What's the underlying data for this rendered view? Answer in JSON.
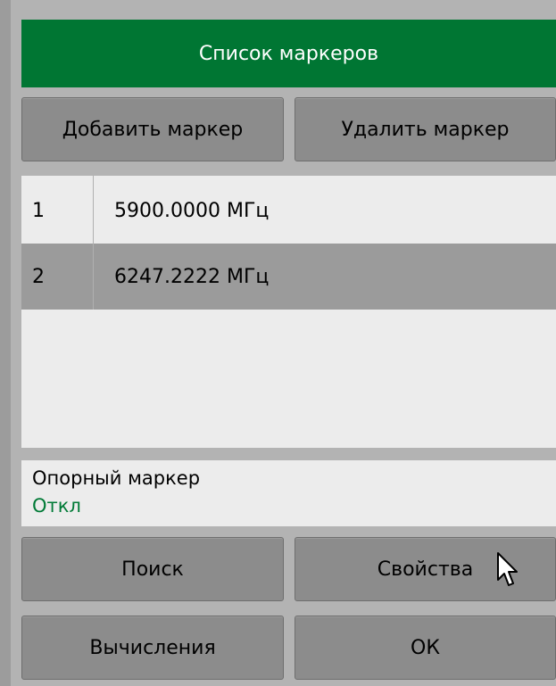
{
  "dialog": {
    "title": "Список маркеров",
    "add_button": "Добавить маркер",
    "delete_button": "Удалить маркер"
  },
  "markers": [
    {
      "num": "1",
      "value": "5900.0000  МГц"
    },
    {
      "num": "2",
      "value": "6247.2222  МГц"
    }
  ],
  "reference": {
    "label": "Опорный маркер",
    "value": "Откл"
  },
  "buttons": {
    "search": "Поиск",
    "properties": "Свойства",
    "calculations": "Вычисления",
    "ok": "ОК"
  },
  "colors": {
    "title_bg": "#007633",
    "ref_value": "#007a36",
    "selected_row": "#9b9b9b"
  }
}
